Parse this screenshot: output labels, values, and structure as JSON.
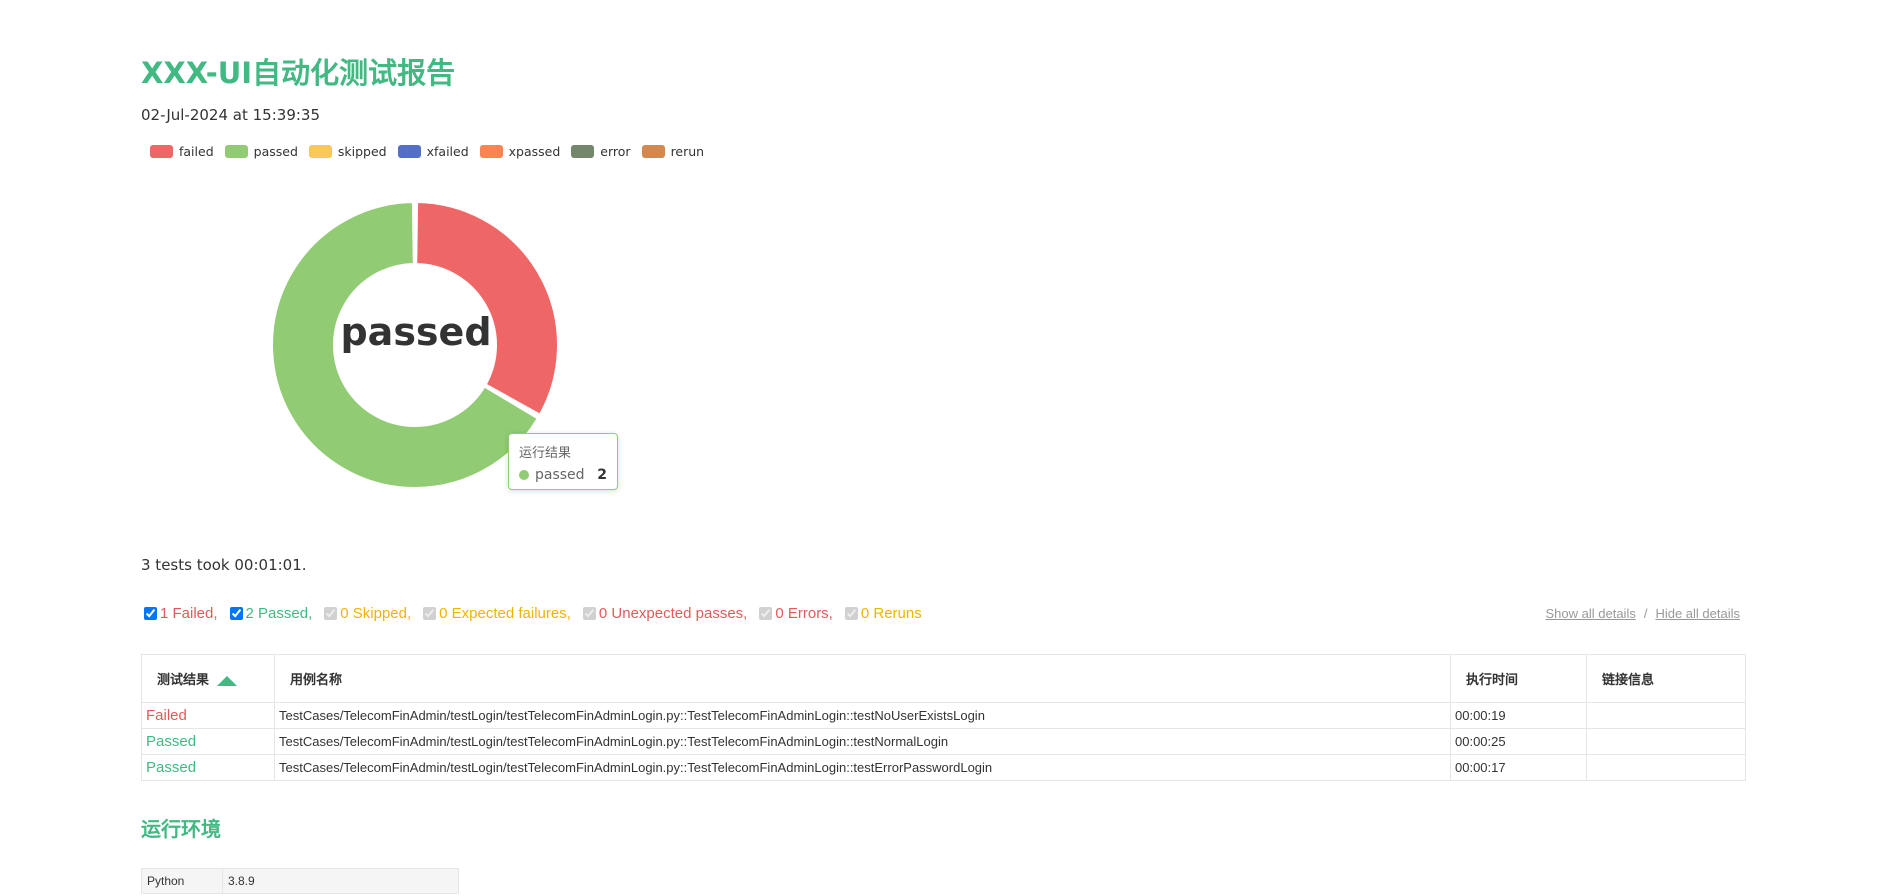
{
  "report": {
    "title": "XXX-UI自动化测试报告",
    "generated": "02-Jul-2024 at 15:39:35",
    "summary": "3 tests took 00:01:01."
  },
  "legend": [
    {
      "label": "failed",
      "color": "#ee6666"
    },
    {
      "label": "passed",
      "color": "#91cc75"
    },
    {
      "label": "skipped",
      "color": "#fac858"
    },
    {
      "label": "xfailed",
      "color": "#5470c6"
    },
    {
      "label": "xpassed",
      "color": "#fc8452"
    },
    {
      "label": "error",
      "color": "#73876d"
    },
    {
      "label": "rerun",
      "color": "#d4884f"
    }
  ],
  "chart_data": {
    "type": "pie",
    "categories": [
      "failed",
      "passed",
      "skipped",
      "xfailed",
      "xpassed",
      "error",
      "rerun"
    ],
    "values": [
      1,
      2,
      0,
      0,
      0,
      0,
      0
    ],
    "center_label": "passed",
    "legend_position": "top-left",
    "tooltip": {
      "title": "运行结果",
      "label": "passed",
      "value": 2
    }
  },
  "filters": [
    {
      "label": "1 Failed,",
      "checked": true,
      "enabled": true,
      "color": "#e25a5a"
    },
    {
      "label": "2 Passed,",
      "checked": true,
      "enabled": true,
      "color": "#42b983"
    },
    {
      "label": "0 Skipped,",
      "checked": true,
      "enabled": false,
      "color": "#f0b400"
    },
    {
      "label": "0 Expected failures,",
      "checked": true,
      "enabled": false,
      "color": "#f0b400"
    },
    {
      "label": "0 Unexpected passes,",
      "checked": true,
      "enabled": false,
      "color": "#e25a5a"
    },
    {
      "label": "0 Errors,",
      "checked": true,
      "enabled": false,
      "color": "#e25a5a"
    },
    {
      "label": "0 Reruns",
      "checked": true,
      "enabled": false,
      "color": "#f0b400"
    }
  ],
  "details_links": {
    "show": "Show all details",
    "separator": "/",
    "hide": "Hide all details"
  },
  "results_table": {
    "headers": [
      "测试结果",
      "用例名称",
      "执行时间",
      "链接信息"
    ],
    "rows": [
      {
        "result": "Failed",
        "status": "failed",
        "name": "TestCases/TelecomFinAdmin/testLogin/testTelecomFinAdminLogin.py::TestTelecomFinAdminLogin::testNoUserExistsLogin",
        "duration": "00:00:19",
        "links": ""
      },
      {
        "result": "Passed",
        "status": "passed",
        "name": "TestCases/TelecomFinAdmin/testLogin/testTelecomFinAdminLogin.py::TestTelecomFinAdminLogin::testNormalLogin",
        "duration": "00:00:25",
        "links": ""
      },
      {
        "result": "Passed",
        "status": "passed",
        "name": "TestCases/TelecomFinAdmin/testLogin/testTelecomFinAdminLogin.py::TestTelecomFinAdminLogin::testErrorPasswordLogin",
        "duration": "00:00:17",
        "links": ""
      }
    ]
  },
  "environment": {
    "title": "运行环境",
    "rows": [
      {
        "key": "Python",
        "value": "3.8.9"
      }
    ]
  }
}
